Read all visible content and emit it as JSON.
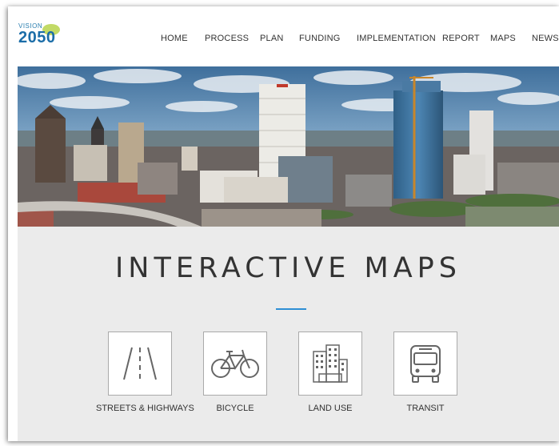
{
  "logo": {
    "line1": "VISION",
    "line2": "2050"
  },
  "nav": {
    "items": [
      {
        "label": "HOME"
      },
      {
        "label": "PROCESS"
      },
      {
        "label": "PLAN"
      },
      {
        "label": "FUNDING"
      },
      {
        "label": "IMPLEMENTATION"
      },
      {
        "label": "REPORT"
      },
      {
        "label": "MAPS"
      },
      {
        "label": "NEWS"
      }
    ]
  },
  "banner": {
    "subject": "city skyline"
  },
  "maps_section": {
    "title": "INTERACTIVE MAPS",
    "cards": [
      {
        "label": "STREETS & HIGHWAYS",
        "icon": "road-icon"
      },
      {
        "label": "BICYCLE",
        "icon": "bicycle-icon"
      },
      {
        "label": "LAND USE",
        "icon": "buildings-icon"
      },
      {
        "label": "TRANSIT",
        "icon": "bus-icon"
      }
    ]
  },
  "colors": {
    "accent": "#2e8fd4",
    "brand": "#1b6da8",
    "section_bg": "#ebebeb"
  }
}
